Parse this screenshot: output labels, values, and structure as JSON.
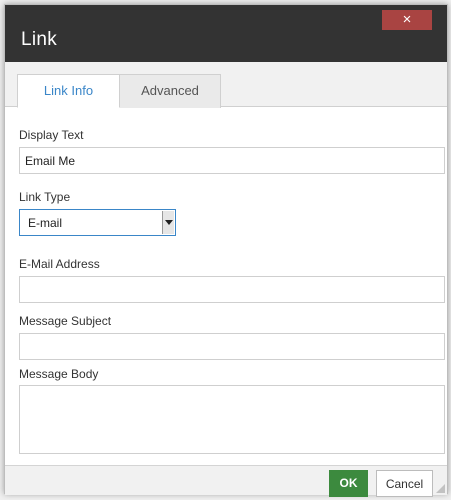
{
  "dialog": {
    "title": "Link",
    "close_glyph": "×"
  },
  "tabs": [
    {
      "label": "Link Info",
      "active": true
    },
    {
      "label": "Advanced",
      "active": false
    }
  ],
  "form": {
    "display_text_label": "Display Text",
    "display_text_value": "Email Me",
    "link_type_label": "Link Type",
    "link_type_value": "E-mail",
    "email_label": "E-Mail Address",
    "email_value": "",
    "subject_label": "Message Subject",
    "subject_value": "",
    "body_label": "Message Body",
    "body_value": ""
  },
  "footer": {
    "ok_label": "OK",
    "cancel_label": "Cancel"
  },
  "colors": {
    "titlebar": "#333333",
    "close_button": "#a94442",
    "active_tab_text": "#3a86c8",
    "ok_button": "#3c8a3e"
  },
  "icons": {
    "close": "close-icon",
    "dropdown": "chevron-down-icon",
    "resize": "resize-grip-icon"
  }
}
